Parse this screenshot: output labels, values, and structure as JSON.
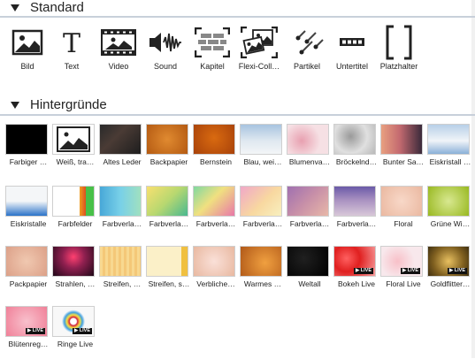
{
  "standard": {
    "title": "Standard",
    "items": [
      {
        "label": "Bild",
        "icon": "image-icon"
      },
      {
        "label": "Text",
        "icon": "text-icon"
      },
      {
        "label": "Video",
        "icon": "video-icon"
      },
      {
        "label": "Sound",
        "icon": "sound-icon"
      },
      {
        "label": "Kapitel",
        "icon": "chapter-icon"
      },
      {
        "label": "Flexi-Coll…",
        "icon": "flexi-collage-icon"
      },
      {
        "label": "Partikel",
        "icon": "particle-icon"
      },
      {
        "label": "Untertitel",
        "icon": "subtitle-icon"
      },
      {
        "label": "Platzhalter",
        "icon": "placeholder-icon"
      }
    ]
  },
  "backgrounds": {
    "title": "Hintergründe",
    "live_badge": "▶ LIVE",
    "tiles": [
      {
        "label": "Farbiger …",
        "bg": "#000000"
      },
      {
        "label": "Weiß, tra…",
        "bg": "#ffffff"
      },
      {
        "label": "Altes Leder",
        "bg": "linear-gradient(135deg,#2a2a2a,#4a3b35 40%,#1e1e1e)"
      },
      {
        "label": "Backpapier",
        "bg": "radial-gradient(circle at 50% 50%,#e08a30,#b45a12)"
      },
      {
        "label": "Bernstein",
        "bg": "radial-gradient(circle at 50% 45%,#d96a10,#a8420a)"
      },
      {
        "label": "Blau, wei…",
        "bg": "linear-gradient(180deg,#a8c4e0,#dfe8f0 55%,#f3f5f7)"
      },
      {
        "label": "Blumenva…",
        "bg": "radial-gradient(circle at 35% 55%,#e8a0b0,#f6e0e4 60%)"
      },
      {
        "label": "Bröckelnd…",
        "bg": "radial-gradient(circle at 40% 40%,#9a9a9a,#e0e0e0 55%,#b8b8b8)"
      },
      {
        "label": "Bunter Sa…",
        "bg": "linear-gradient(90deg,#e8a080,#c46a70 45%,#3a2a3a)"
      },
      {
        "label": "Eiskristall …",
        "bg": "linear-gradient(180deg,#b8d0e8,#f0f4f8 55%,#8ab0d8)"
      },
      {
        "label": "Eiskristalle",
        "bg": "linear-gradient(180deg,#f4f6f8,#f4f6f8 50%,#2a72c8)"
      },
      {
        "label": "Farbfelder",
        "bg": "linear-gradient(90deg,#ffffff 65%,#f0a020 65%,#e05020 80%,#48c048 80%)"
      },
      {
        "label": "Farbverla…",
        "bg": "linear-gradient(90deg,#48a8d8,#78d0e8 50%,#a0e0c0)"
      },
      {
        "label": "Farbverla…",
        "bg": "linear-gradient(135deg,#f8e070,#b8d870 50%,#48b890)"
      },
      {
        "label": "Farbverla…",
        "bg": "linear-gradient(135deg,#80d8a0,#f0e080 45%,#e878a8)"
      },
      {
        "label": "Farbverla…",
        "bg": "linear-gradient(135deg,#f0a8c8,#f8d8a0 55%,#f8f0c0)"
      },
      {
        "label": "Farbverla…",
        "bg": "linear-gradient(135deg,#a070b0,#c890a8 50%,#e8b8a8)"
      },
      {
        "label": "Farbverla…",
        "bg": "linear-gradient(180deg,#6a5aa8,#a890c0 45%,#d8c8d8)"
      },
      {
        "label": "Floral",
        "bg": "radial-gradient(circle at 50% 50%,#f8d8c8,#eab8a0)"
      },
      {
        "label": "Grüne Wi…",
        "bg": "radial-gradient(circle at 50% 50%,#d8e890,#98b820)"
      },
      {
        "label": "Packpapier",
        "bg": "radial-gradient(circle at 50% 50%,#f0c8b0,#dca088)"
      },
      {
        "label": "Strahlen, …",
        "bg": "radial-gradient(circle at 50% 35%,#ff4070,#902050 40%,#200818)"
      },
      {
        "label": "Streifen, …",
        "bg": "repeating-linear-gradient(90deg,#f8d890 0 3px,#f4c878 3px 6px)"
      },
      {
        "label": "Streifen, s…",
        "bg": "linear-gradient(90deg,#fbf0c8 85%,#f0c040 85%)"
      },
      {
        "label": "Verbliche…",
        "bg": "radial-gradient(circle at 50% 50%,#fae0d8,#e8b8a0)"
      },
      {
        "label": "Warmes …",
        "bg": "radial-gradient(circle at 60% 55%,#f0a040,#b05818)"
      },
      {
        "label": "Weltall",
        "bg": "radial-gradient(circle at 40% 40%,#202020,#000000)"
      },
      {
        "label": "Bokeh Live",
        "bg": "radial-gradient(circle at 30% 40%,#ff6060,#e02020 40%,#f8a0a0)",
        "live": true
      },
      {
        "label": "Floral Live",
        "bg": "radial-gradient(circle at 40% 50%,#f8c0c8,#f8e8ec 60%)",
        "live": true
      },
      {
        "label": "Goldflitter…",
        "bg": "radial-gradient(circle at 50% 50%,#e8c060,#806020 60%,#403010)",
        "live": true
      },
      {
        "label": "Blütenreg…",
        "bg": "radial-gradient(circle at 50% 50%,#f8c0cc,#f08098)",
        "live": true
      },
      {
        "label": "Ringe Live",
        "bg": "radial-gradient(circle at 50% 50%,#ffffff 12%,#d02040 16%,#f8e040 26%,#40a0e0 36%,#f8f8f8 46%)",
        "live": true
      }
    ]
  }
}
